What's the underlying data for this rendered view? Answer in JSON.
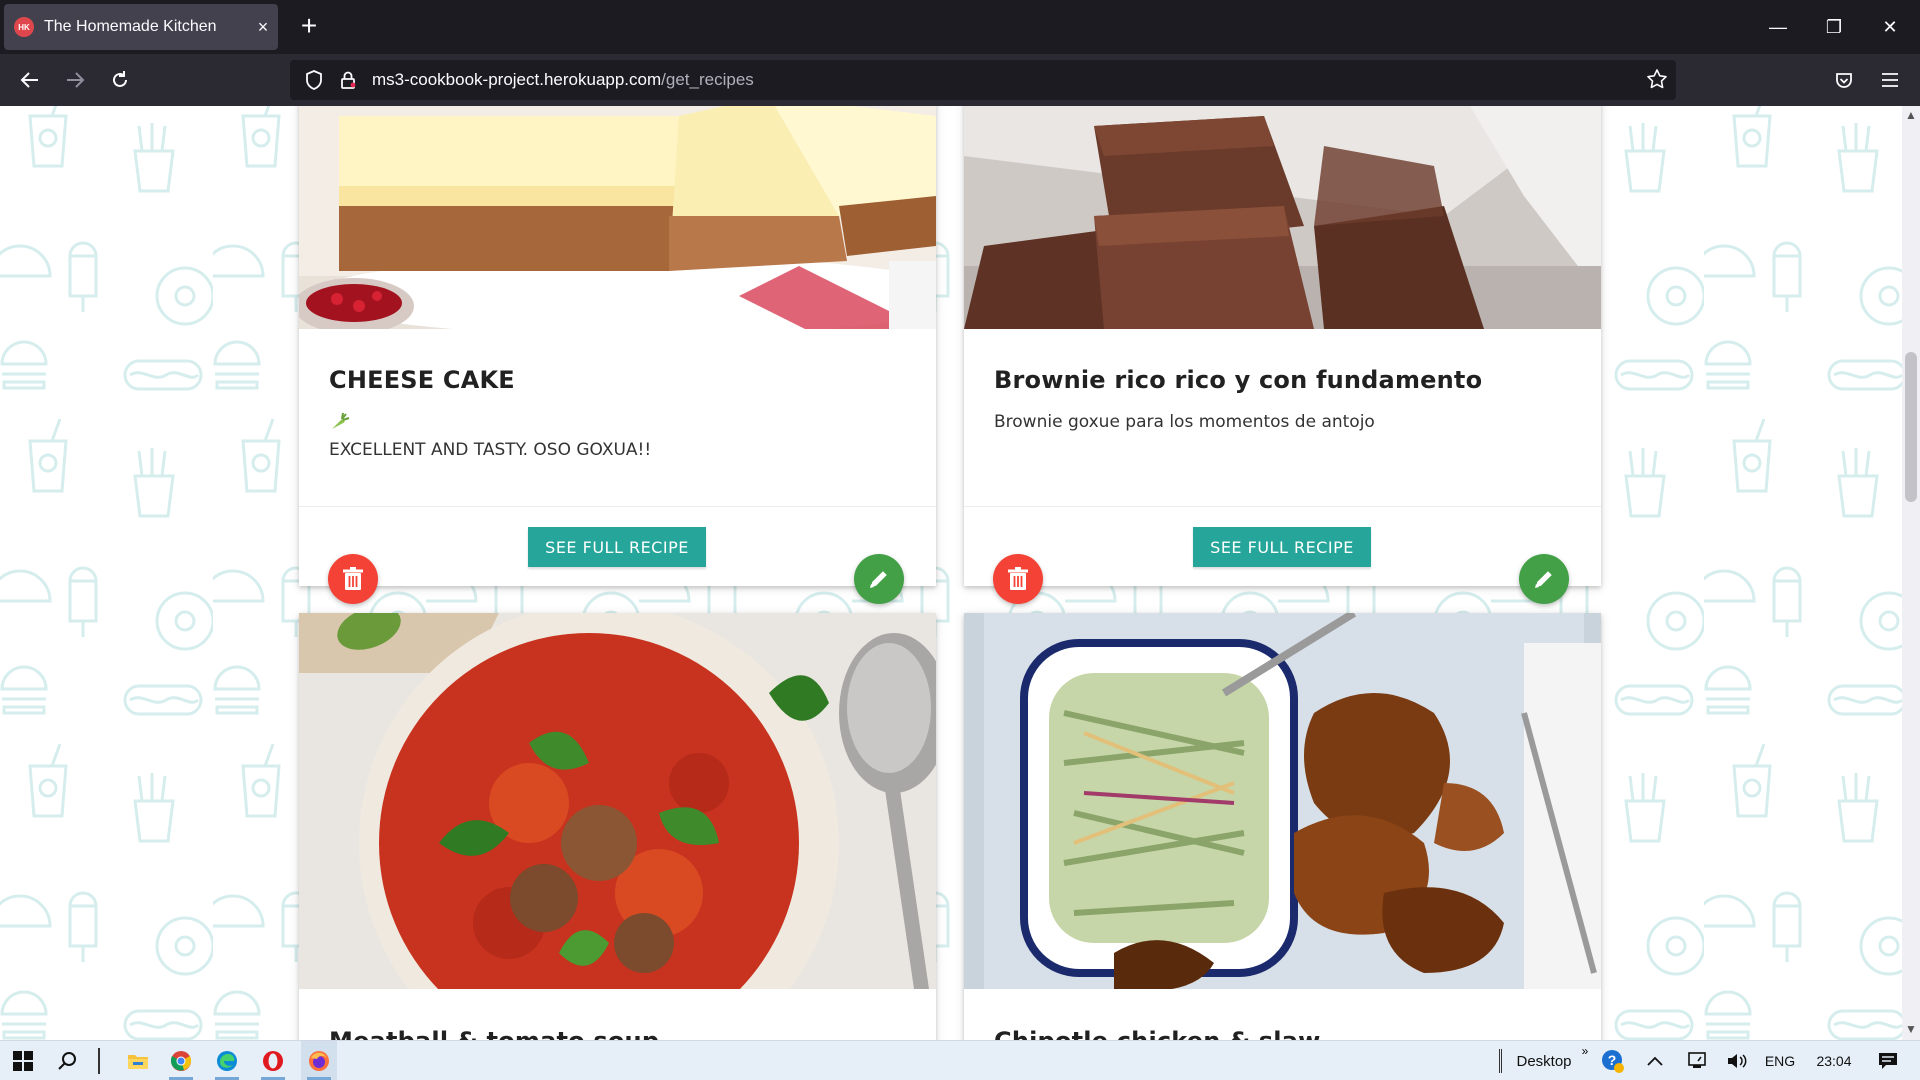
{
  "browser": {
    "tab_title": "The Homemade Kitchen",
    "tab_favicon_text": "HK",
    "tab_close": "×",
    "new_tab": "+",
    "url_domain": "ms3-cookbook-project.herokuapp.com",
    "url_path": "/get_recipes",
    "window_controls": {
      "minimize": "—",
      "restore": "❐",
      "close": "✕"
    }
  },
  "recipes": [
    {
      "title": "CHEESE CAKE",
      "vegetarian_icon": "carrot-icon",
      "description": "EXCELLENT AND TASTY. OSO GOXUA!!",
      "button": "SEE FULL RECIPE"
    },
    {
      "title": "Brownie rico rico y con fundamento",
      "description": "Brownie goxue para los momentos de antojo",
      "button": "SEE FULL RECIPE"
    },
    {
      "title": "Meatball & tomato soup"
    },
    {
      "title": "Chipotle chicken & slaw"
    }
  ],
  "taskbar": {
    "desktop_label": "Desktop",
    "chevron": "»",
    "language": "ENG",
    "time": "23:04"
  },
  "colors": {
    "teal": "#26a69a",
    "delete_red": "#f44336",
    "edit_green": "#43a047",
    "pattern": "#d4ecec"
  }
}
